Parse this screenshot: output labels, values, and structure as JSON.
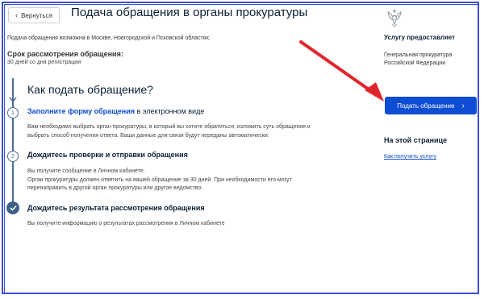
{
  "header": {
    "back_label": "Вернуться",
    "title": "Подача обращения в органы прокуратуры"
  },
  "info": {
    "intro": "Подача обращения возможна в Москве, Новгородской и Псковской областях.",
    "term_title": "Срок рассмотрения обращения:",
    "term_value": "30 дней со дня регистрации"
  },
  "how": {
    "title": "Как подать обращение?",
    "steps": [
      {
        "number": "1",
        "title_link": "Заполните форму обращения",
        "title_rest": " в электронном виде",
        "lines": [
          "Вам необходимо выбрать орган прокуратуры, в который вы хотите обратиться, изложить суть обращения и",
          "выбрать способ получения ответа. Ваши данные для связи будут переданы автоматически."
        ]
      },
      {
        "number": "2",
        "title": "Дождитесь проверки и отправки обращения",
        "lines": [
          "Вы получите сообщение в Личном кабинете.",
          "Орган прокуратуры должен ответить на вашей обращение за 30 дней. При необходимости его могут",
          "перенаправить в другой орган прокуратуры или другое ведомство."
        ]
      },
      {
        "title": "Дождитесь результата рассмотрения обращения",
        "lines": [
          "Вы получите информацию о результатах рассмотрения в Личном кабинете"
        ]
      }
    ]
  },
  "sidebar": {
    "provider_title": "Услугу предоставляет",
    "provider_lines": [
      "Генеральная прокуратура",
      "Российской Федерации"
    ],
    "submit_label": "Подать обращение",
    "onpage_title": "На этой странице",
    "onpage_link": "Как получить услугу"
  },
  "colors": {
    "accent": "#0d4cd3",
    "frame": "#3a4fd6",
    "annotation_arrow": "#e0262b",
    "timeline": "#4b6c96"
  },
  "icons": [
    "chevron-left-icon",
    "emblem-icon",
    "check-icon",
    "chevron-right-icon",
    "arrow-down-icon"
  ]
}
